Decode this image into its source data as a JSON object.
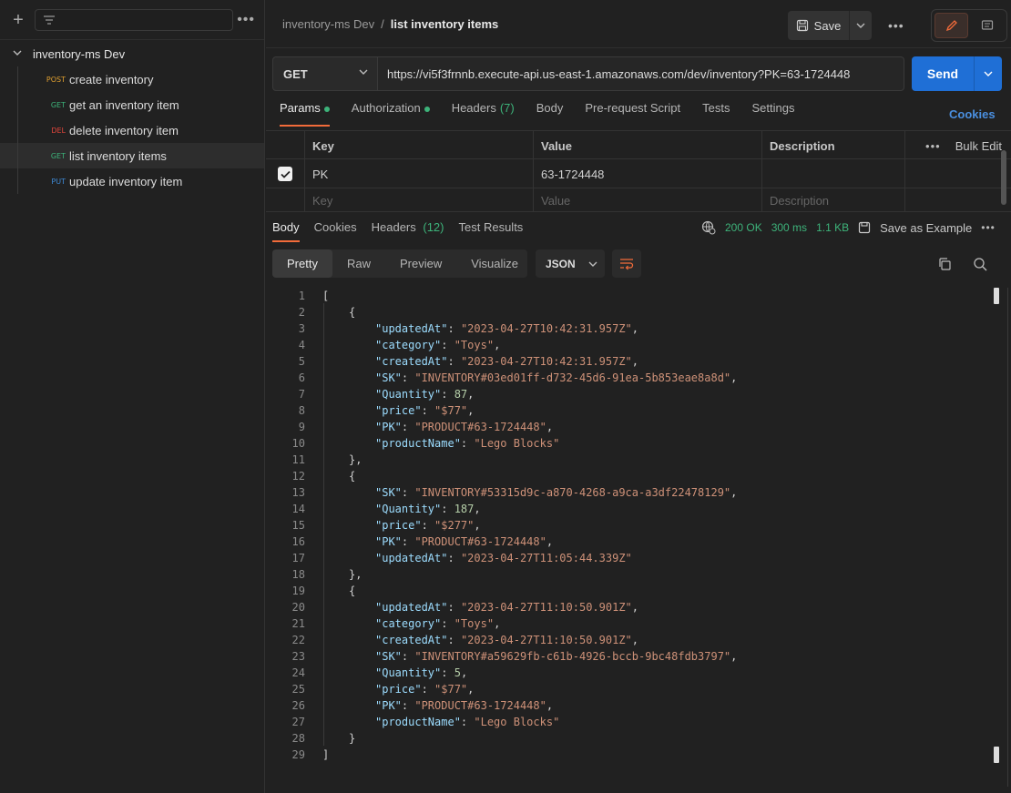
{
  "sidebar": {
    "collection_name": "inventory-ms Dev",
    "requests": [
      {
        "method": "POST",
        "name": "create inventory"
      },
      {
        "method": "GET",
        "name": "get an inventory item"
      },
      {
        "method": "DEL",
        "name": "delete inventory item"
      },
      {
        "method": "GET",
        "name": "list inventory items"
      },
      {
        "method": "PUT",
        "name": "update inventory item"
      }
    ]
  },
  "header": {
    "breadcrumb_parent": "inventory-ms Dev",
    "breadcrumb_sep": "/",
    "breadcrumb_current": "list inventory items",
    "save_label": "Save"
  },
  "request": {
    "method": "GET",
    "url": "https://vi5f3frnnb.execute-api.us-east-1.amazonaws.com/dev/inventory?PK=63-1724448",
    "send_label": "Send"
  },
  "request_tabs": {
    "params": "Params",
    "authorization": "Authorization",
    "headers": "Headers",
    "headers_count": "(7)",
    "body": "Body",
    "prerequest": "Pre-request Script",
    "tests": "Tests",
    "settings": "Settings",
    "cookies": "Cookies"
  },
  "params_table": {
    "headers": {
      "key": "Key",
      "value": "Value",
      "description": "Description",
      "bulk_edit": "Bulk Edit"
    },
    "row": {
      "key": "PK",
      "value": "63-1724448"
    },
    "placeholders": {
      "key": "Key",
      "value": "Value",
      "description": "Description"
    }
  },
  "response_tabs": {
    "body": "Body",
    "cookies": "Cookies",
    "headers": "Headers",
    "headers_count": "(12)",
    "test_results": "Test Results"
  },
  "response_meta": {
    "status": "200 OK",
    "time": "300 ms",
    "size": "1.1 KB",
    "save_example": "Save as Example"
  },
  "view_modes": {
    "pretty": "Pretty",
    "raw": "Raw",
    "preview": "Preview",
    "visualize": "Visualize",
    "format": "JSON"
  },
  "code_lines": [
    {
      "n": "1",
      "indent": 0,
      "parts": [
        [
          "p",
          "["
        ]
      ]
    },
    {
      "n": "2",
      "indent": 1,
      "parts": [
        [
          "p",
          "{"
        ]
      ]
    },
    {
      "n": "3",
      "indent": 2,
      "parts": [
        [
          "k",
          "\"updatedAt\""
        ],
        [
          "p",
          ": "
        ],
        [
          "s",
          "\"2023-04-27T10:42:31.957Z\""
        ],
        [
          "p",
          ","
        ]
      ]
    },
    {
      "n": "4",
      "indent": 2,
      "parts": [
        [
          "k",
          "\"category\""
        ],
        [
          "p",
          ": "
        ],
        [
          "s",
          "\"Toys\""
        ],
        [
          "p",
          ","
        ]
      ]
    },
    {
      "n": "5",
      "indent": 2,
      "parts": [
        [
          "k",
          "\"createdAt\""
        ],
        [
          "p",
          ": "
        ],
        [
          "s",
          "\"2023-04-27T10:42:31.957Z\""
        ],
        [
          "p",
          ","
        ]
      ]
    },
    {
      "n": "6",
      "indent": 2,
      "parts": [
        [
          "k",
          "\"SK\""
        ],
        [
          "p",
          ": "
        ],
        [
          "s",
          "\"INVENTORY#03ed01ff-d732-45d6-91ea-5b853eae8a8d\""
        ],
        [
          "p",
          ","
        ]
      ]
    },
    {
      "n": "7",
      "indent": 2,
      "parts": [
        [
          "k",
          "\"Quantity\""
        ],
        [
          "p",
          ": "
        ],
        [
          "n",
          "87"
        ],
        [
          "p",
          ","
        ]
      ]
    },
    {
      "n": "8",
      "indent": 2,
      "parts": [
        [
          "k",
          "\"price\""
        ],
        [
          "p",
          ": "
        ],
        [
          "s",
          "\"$77\""
        ],
        [
          "p",
          ","
        ]
      ]
    },
    {
      "n": "9",
      "indent": 2,
      "parts": [
        [
          "k",
          "\"PK\""
        ],
        [
          "p",
          ": "
        ],
        [
          "s",
          "\"PRODUCT#63-1724448\""
        ],
        [
          "p",
          ","
        ]
      ]
    },
    {
      "n": "10",
      "indent": 2,
      "parts": [
        [
          "k",
          "\"productName\""
        ],
        [
          "p",
          ": "
        ],
        [
          "s",
          "\"Lego Blocks\""
        ]
      ]
    },
    {
      "n": "11",
      "indent": 1,
      "parts": [
        [
          "p",
          "},"
        ]
      ]
    },
    {
      "n": "12",
      "indent": 1,
      "parts": [
        [
          "p",
          "{"
        ]
      ]
    },
    {
      "n": "13",
      "indent": 2,
      "parts": [
        [
          "k",
          "\"SK\""
        ],
        [
          "p",
          ": "
        ],
        [
          "s",
          "\"INVENTORY#53315d9c-a870-4268-a9ca-a3df22478129\""
        ],
        [
          "p",
          ","
        ]
      ]
    },
    {
      "n": "14",
      "indent": 2,
      "parts": [
        [
          "k",
          "\"Quantity\""
        ],
        [
          "p",
          ": "
        ],
        [
          "n",
          "187"
        ],
        [
          "p",
          ","
        ]
      ]
    },
    {
      "n": "15",
      "indent": 2,
      "parts": [
        [
          "k",
          "\"price\""
        ],
        [
          "p",
          ": "
        ],
        [
          "s",
          "\"$277\""
        ],
        [
          "p",
          ","
        ]
      ]
    },
    {
      "n": "16",
      "indent": 2,
      "parts": [
        [
          "k",
          "\"PK\""
        ],
        [
          "p",
          ": "
        ],
        [
          "s",
          "\"PRODUCT#63-1724448\""
        ],
        [
          "p",
          ","
        ]
      ]
    },
    {
      "n": "17",
      "indent": 2,
      "parts": [
        [
          "k",
          "\"updatedAt\""
        ],
        [
          "p",
          ": "
        ],
        [
          "s",
          "\"2023-04-27T11:05:44.339Z\""
        ]
      ]
    },
    {
      "n": "18",
      "indent": 1,
      "parts": [
        [
          "p",
          "},"
        ]
      ]
    },
    {
      "n": "19",
      "indent": 1,
      "parts": [
        [
          "p",
          "{"
        ]
      ]
    },
    {
      "n": "20",
      "indent": 2,
      "parts": [
        [
          "k",
          "\"updatedAt\""
        ],
        [
          "p",
          ": "
        ],
        [
          "s",
          "\"2023-04-27T11:10:50.901Z\""
        ],
        [
          "p",
          ","
        ]
      ]
    },
    {
      "n": "21",
      "indent": 2,
      "parts": [
        [
          "k",
          "\"category\""
        ],
        [
          "p",
          ": "
        ],
        [
          "s",
          "\"Toys\""
        ],
        [
          "p",
          ","
        ]
      ]
    },
    {
      "n": "22",
      "indent": 2,
      "parts": [
        [
          "k",
          "\"createdAt\""
        ],
        [
          "p",
          ": "
        ],
        [
          "s",
          "\"2023-04-27T11:10:50.901Z\""
        ],
        [
          "p",
          ","
        ]
      ]
    },
    {
      "n": "23",
      "indent": 2,
      "parts": [
        [
          "k",
          "\"SK\""
        ],
        [
          "p",
          ": "
        ],
        [
          "s",
          "\"INVENTORY#a59629fb-c61b-4926-bccb-9bc48fdb3797\""
        ],
        [
          "p",
          ","
        ]
      ]
    },
    {
      "n": "24",
      "indent": 2,
      "parts": [
        [
          "k",
          "\"Quantity\""
        ],
        [
          "p",
          ": "
        ],
        [
          "n",
          "5"
        ],
        [
          "p",
          ","
        ]
      ]
    },
    {
      "n": "25",
      "indent": 2,
      "parts": [
        [
          "k",
          "\"price\""
        ],
        [
          "p",
          ": "
        ],
        [
          "s",
          "\"$77\""
        ],
        [
          "p",
          ","
        ]
      ]
    },
    {
      "n": "26",
      "indent": 2,
      "parts": [
        [
          "k",
          "\"PK\""
        ],
        [
          "p",
          ": "
        ],
        [
          "s",
          "\"PRODUCT#63-1724448\""
        ],
        [
          "p",
          ","
        ]
      ]
    },
    {
      "n": "27",
      "indent": 2,
      "parts": [
        [
          "k",
          "\"productName\""
        ],
        [
          "p",
          ": "
        ],
        [
          "s",
          "\"Lego Blocks\""
        ]
      ]
    },
    {
      "n": "28",
      "indent": 1,
      "parts": [
        [
          "p",
          "}"
        ]
      ]
    },
    {
      "n": "29",
      "indent": 0,
      "parts": [
        [
          "p",
          "]"
        ]
      ]
    }
  ],
  "icons": {
    "new": "plus-icon",
    "filter": "filter-icon",
    "more": "more-horizontal-icon",
    "save": "save-disk-icon",
    "edit": "pencil-icon",
    "comment": "comment-icon",
    "globe": "globe-icon",
    "wrap": "wrap-lines-icon",
    "copy": "copy-icon",
    "search": "search-icon"
  },
  "colors": {
    "accent": "#f26b3a",
    "send": "#1f6fd6",
    "success": "#3db37a",
    "link": "#4a8fe0"
  }
}
